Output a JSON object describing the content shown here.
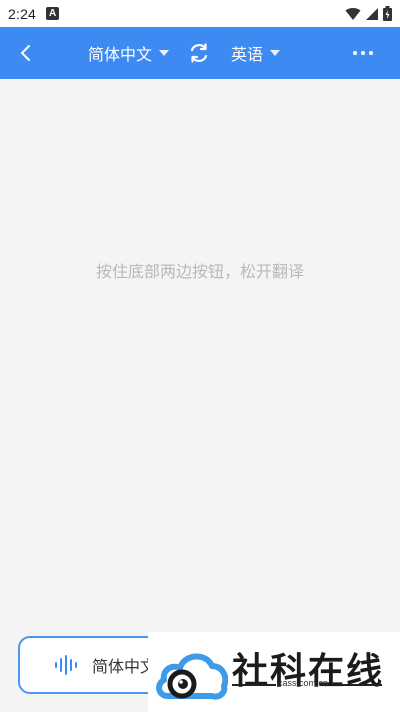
{
  "status_bar": {
    "time": "2:24",
    "notif_letter": "A"
  },
  "app_bar": {
    "source_lang": "简体中文",
    "target_lang": "英语"
  },
  "main": {
    "hint": "按住底部两边按钮，松开翻译"
  },
  "bottom": {
    "left_button_label": "简体中文"
  },
  "watermark": {
    "title": "社科在线",
    "subtitle": "cass.com.cn"
  },
  "colors": {
    "accent": "#3d8bf2",
    "hint_text": "#b9b9b9",
    "background": "#f4f4f4"
  },
  "icons": {
    "back": "chevron-left-icon",
    "swap": "refresh-icon",
    "more": "more-dots-icon",
    "voice": "voice-wave-icon"
  }
}
